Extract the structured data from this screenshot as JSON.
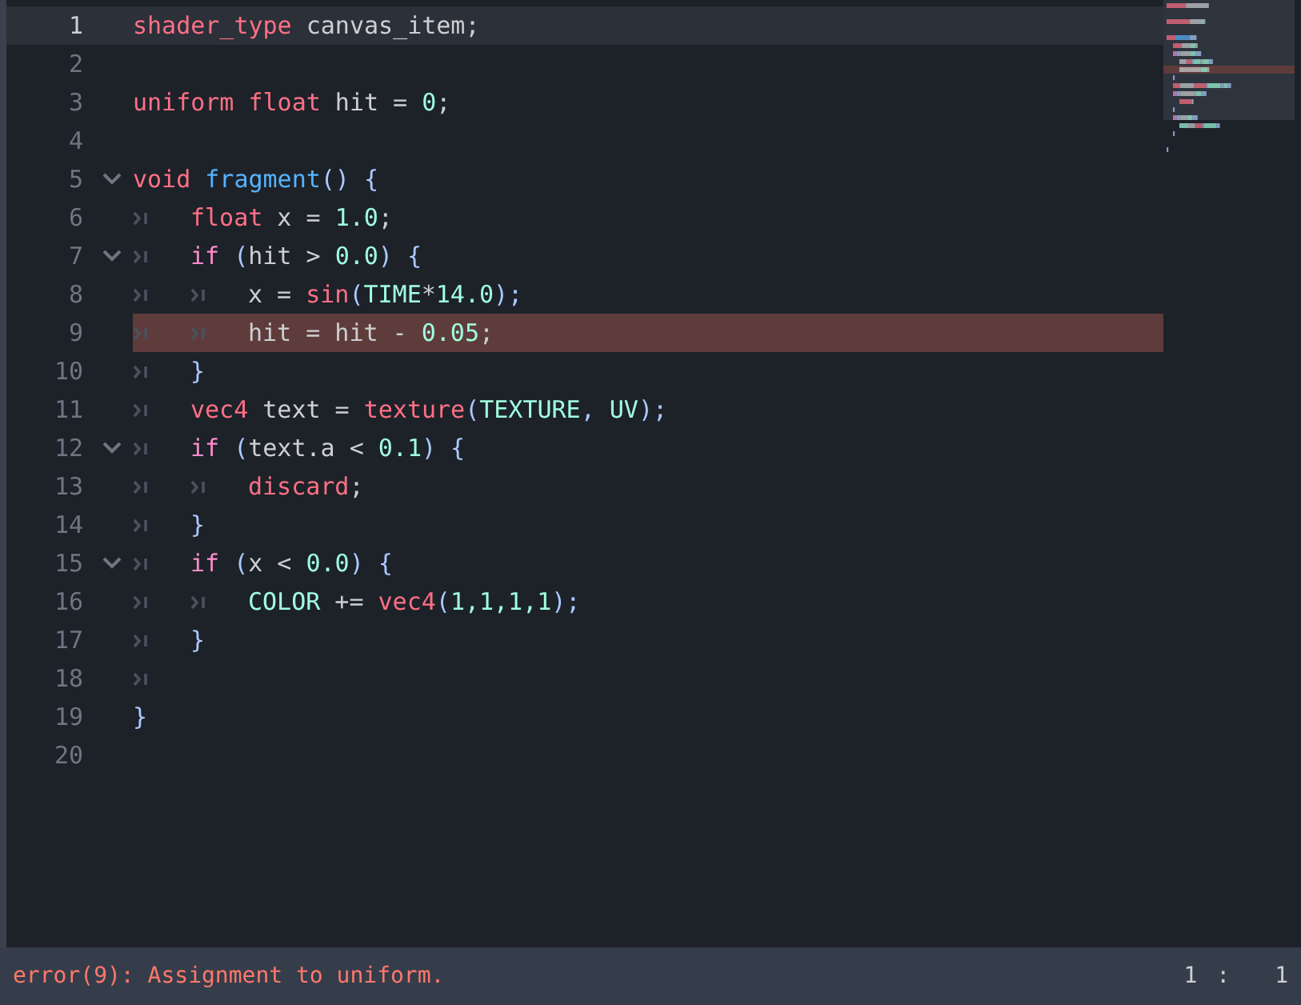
{
  "editor": {
    "lines": [
      {
        "number": "1",
        "foldable": false,
        "current": true,
        "error": false,
        "tokens": [
          {
            "text": "shader_type",
            "kind": "kw"
          },
          {
            "text": " canvas_item;",
            "kind": "id"
          }
        ]
      },
      {
        "number": "2",
        "foldable": false,
        "current": false,
        "error": false
      },
      {
        "number": "3",
        "foldable": false,
        "current": false,
        "error": false,
        "tokens": [
          {
            "text": "uniform float",
            "kind": "kw"
          },
          {
            "text": " hit = ",
            "kind": "id"
          },
          {
            "text": "0",
            "kind": "num"
          },
          {
            "text": ";",
            "kind": "id"
          }
        ]
      },
      {
        "number": "4",
        "foldable": false,
        "current": false,
        "error": false
      },
      {
        "number": "5",
        "foldable": true,
        "current": false,
        "error": false,
        "tokens": [
          {
            "text": "void ",
            "kind": "kw"
          },
          {
            "text": "fragment",
            "kind": "fn"
          },
          {
            "text": "() {",
            "kind": "sym"
          }
        ]
      },
      {
        "number": "6",
        "foldable": false,
        "current": false,
        "error": false,
        "indent": [
          {
            "kind": "tab"
          }
        ],
        "tokens": [
          {
            "text": "float",
            "kind": "kw"
          },
          {
            "text": " x = ",
            "kind": "id"
          },
          {
            "text": "1.0",
            "kind": "num"
          },
          {
            "text": ";",
            "kind": "id"
          }
        ]
      },
      {
        "number": "7",
        "foldable": true,
        "current": false,
        "error": false,
        "indent": [
          {
            "kind": "tab"
          }
        ],
        "tokens": [
          {
            "text": "if",
            "kind": "ctrl"
          },
          {
            "text": " (",
            "kind": "sym"
          },
          {
            "text": "hit > ",
            "kind": "id"
          },
          {
            "text": "0.0",
            "kind": "num"
          },
          {
            "text": ") {",
            "kind": "sym"
          }
        ]
      },
      {
        "number": "8",
        "foldable": false,
        "current": false,
        "error": false,
        "indent": [
          {
            "kind": "tab"
          },
          {
            "kind": "tab"
          }
        ],
        "tokens": [
          {
            "text": "x = ",
            "kind": "id"
          },
          {
            "text": "sin",
            "kind": "kw"
          },
          {
            "text": "(",
            "kind": "sym"
          },
          {
            "text": "TIME",
            "kind": "const"
          },
          {
            "text": "*",
            "kind": "id"
          },
          {
            "text": "14.0",
            "kind": "num"
          },
          {
            "text": ");",
            "kind": "sym"
          }
        ]
      },
      {
        "number": "9",
        "foldable": false,
        "current": false,
        "error": true,
        "indent": [
          {
            "kind": "tab"
          },
          {
            "kind": "tab"
          }
        ],
        "tokens": [
          {
            "text": "hit = hit - ",
            "kind": "id"
          },
          {
            "text": "0.05",
            "kind": "num"
          },
          {
            "text": ";",
            "kind": "id"
          }
        ]
      },
      {
        "number": "10",
        "foldable": false,
        "current": false,
        "error": false,
        "indent": [
          {
            "kind": "tab"
          }
        ],
        "tokens": [
          {
            "text": "}",
            "kind": "sym"
          }
        ]
      },
      {
        "number": "11",
        "foldable": false,
        "current": false,
        "error": false,
        "indent": [
          {
            "kind": "tab"
          }
        ],
        "tokens": [
          {
            "text": "vec4",
            "kind": "kw"
          },
          {
            "text": " text = ",
            "kind": "id"
          },
          {
            "text": "texture",
            "kind": "kw"
          },
          {
            "text": "(",
            "kind": "sym"
          },
          {
            "text": "TEXTURE",
            "kind": "const"
          },
          {
            "text": ", ",
            "kind": "sym"
          },
          {
            "text": "UV",
            "kind": "const"
          },
          {
            "text": ");",
            "kind": "sym"
          }
        ]
      },
      {
        "number": "12",
        "foldable": true,
        "current": false,
        "error": false,
        "indent": [
          {
            "kind": "tab"
          }
        ],
        "tokens": [
          {
            "text": "if",
            "kind": "ctrl"
          },
          {
            "text": " (",
            "kind": "sym"
          },
          {
            "text": "text.a < ",
            "kind": "id"
          },
          {
            "text": "0.1",
            "kind": "num"
          },
          {
            "text": ") {",
            "kind": "sym"
          }
        ]
      },
      {
        "number": "13",
        "foldable": false,
        "current": false,
        "error": false,
        "indent": [
          {
            "kind": "tab"
          },
          {
            "kind": "tab"
          }
        ],
        "tokens": [
          {
            "text": "discard",
            "kind": "kw"
          },
          {
            "text": ";",
            "kind": "id"
          }
        ]
      },
      {
        "number": "14",
        "foldable": false,
        "current": false,
        "error": false,
        "indent": [
          {
            "kind": "tab"
          }
        ],
        "tokens": [
          {
            "text": "}",
            "kind": "sym"
          }
        ]
      },
      {
        "number": "15",
        "foldable": true,
        "current": false,
        "error": false,
        "indent": [
          {
            "kind": "tab"
          }
        ],
        "tokens": [
          {
            "text": "if",
            "kind": "ctrl"
          },
          {
            "text": " (",
            "kind": "sym"
          },
          {
            "text": "x < ",
            "kind": "id"
          },
          {
            "text": "0.0",
            "kind": "num"
          },
          {
            "text": ") {",
            "kind": "sym"
          }
        ]
      },
      {
        "number": "16",
        "foldable": false,
        "current": false,
        "error": false,
        "indent": [
          {
            "kind": "tab"
          },
          {
            "kind": "tab"
          }
        ],
        "tokens": [
          {
            "text": "COLOR",
            "kind": "const"
          },
          {
            "text": " += ",
            "kind": "id"
          },
          {
            "text": "vec4",
            "kind": "kw"
          },
          {
            "text": "(",
            "kind": "sym"
          },
          {
            "text": "1,1,1,1",
            "kind": "num"
          },
          {
            "text": ");",
            "kind": "sym"
          }
        ]
      },
      {
        "number": "17",
        "foldable": false,
        "current": false,
        "error": false,
        "indent": [
          {
            "kind": "tab"
          }
        ],
        "tokens": [
          {
            "text": "}",
            "kind": "sym"
          }
        ]
      },
      {
        "number": "18",
        "foldable": false,
        "current": false,
        "error": false,
        "indent": [
          {
            "kind": "tab"
          }
        ]
      },
      {
        "number": "19",
        "foldable": false,
        "current": false,
        "error": false,
        "tokens": [
          {
            "text": "}",
            "kind": "sym"
          }
        ]
      },
      {
        "number": "20",
        "foldable": false,
        "current": false,
        "error": false
      }
    ]
  },
  "status_bar": {
    "message": "error(9): Assignment to uniform.",
    "cursor_line": "1",
    "separator": ":",
    "cursor_column": "1"
  }
}
